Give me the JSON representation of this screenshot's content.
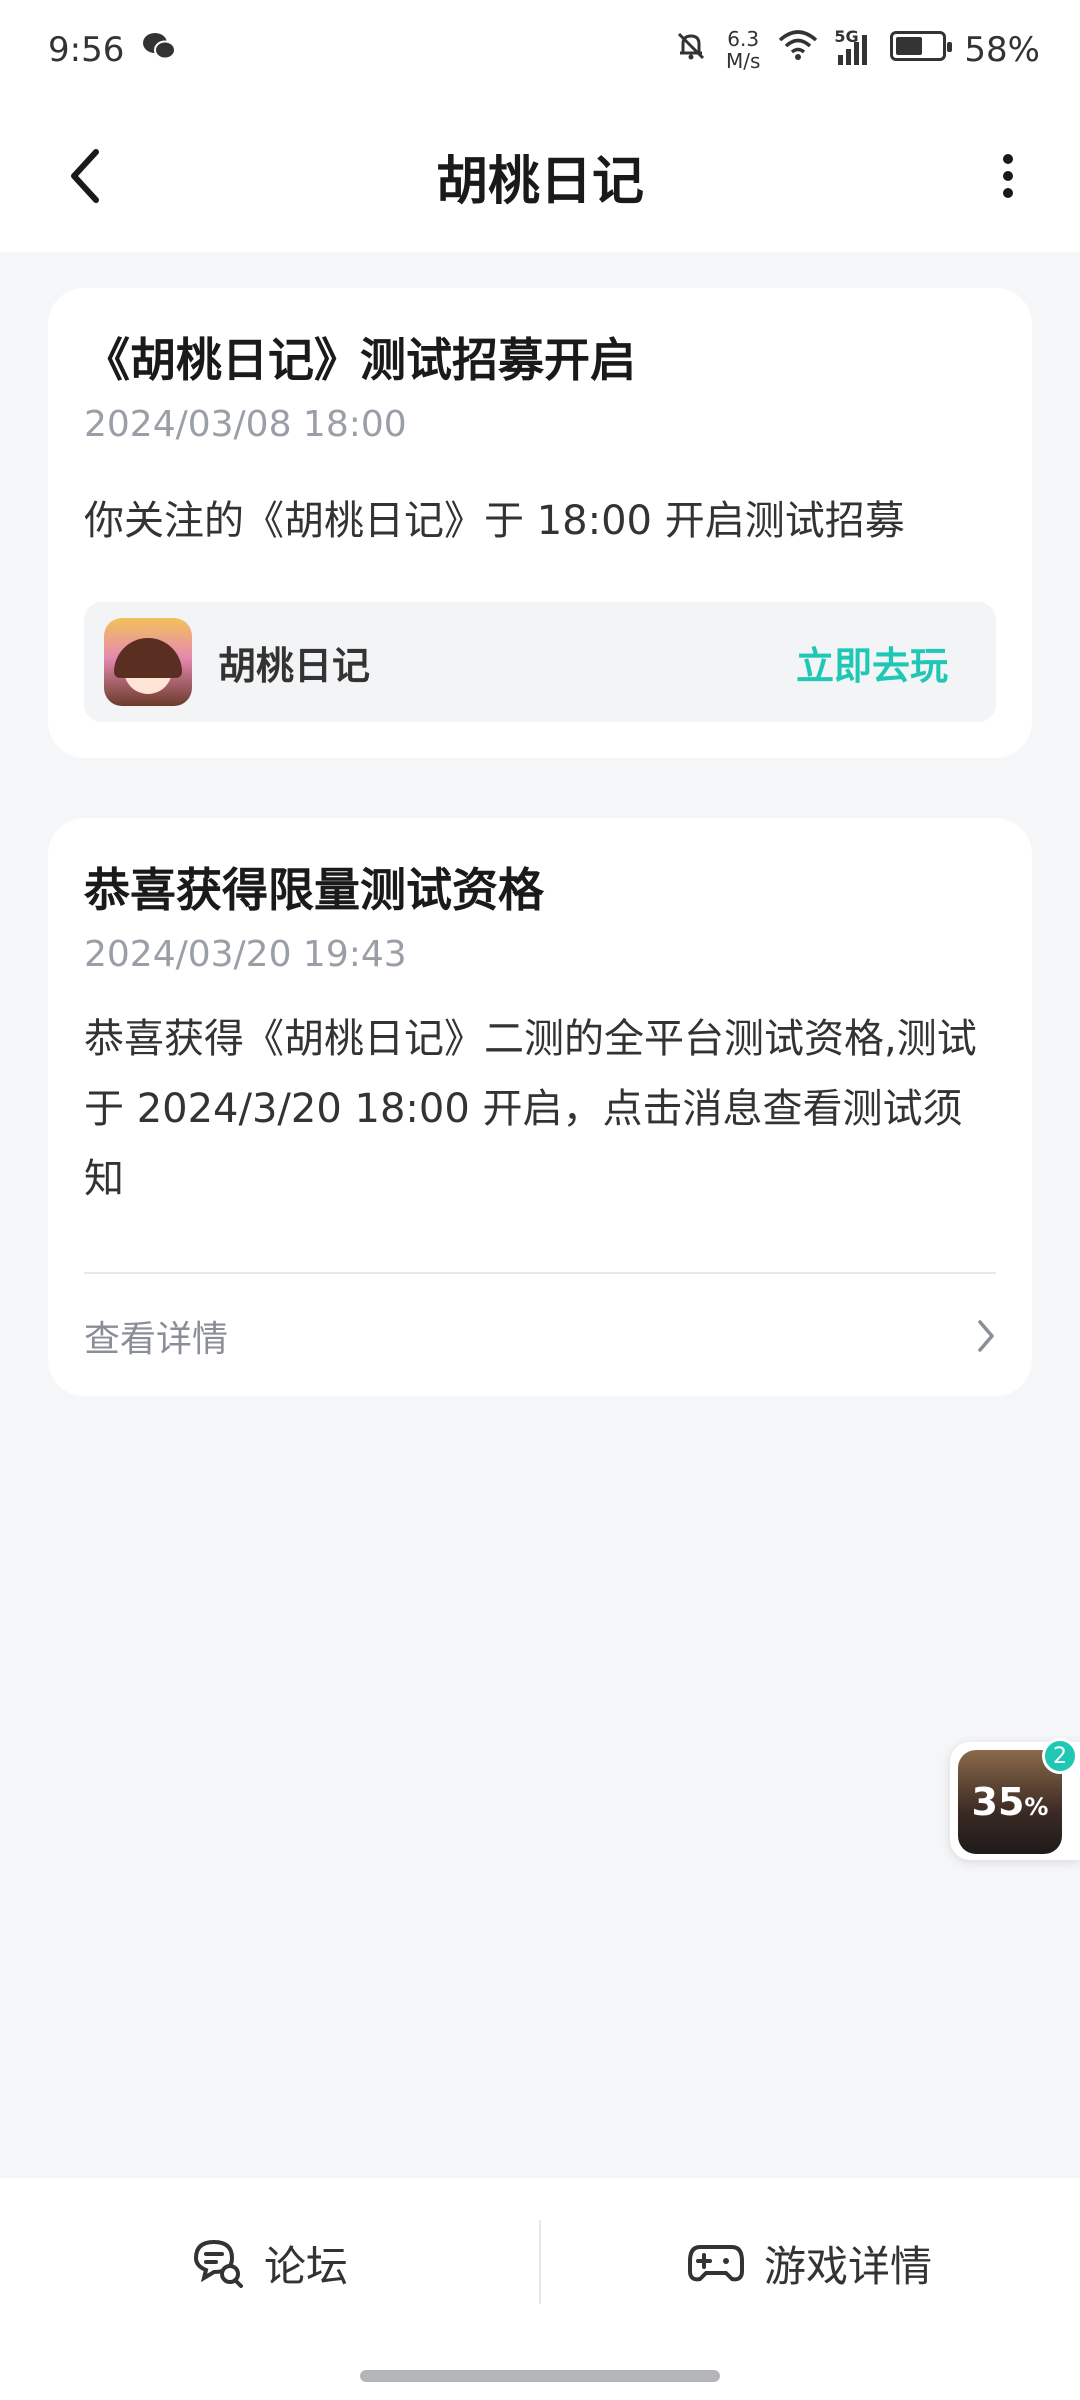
{
  "status_bar": {
    "time": "9:56",
    "speed_value": "6.3",
    "speed_unit": "M/s",
    "network": "5G",
    "battery": "58%",
    "battery_level": 0.58
  },
  "header": {
    "title": "胡桃日记"
  },
  "messages": [
    {
      "title": "《胡桃日记》测试招募开启",
      "time": "2024/03/08 18:00",
      "body": "你关注的《胡桃日记》于 18:00 开启测试招募",
      "game_name": "胡桃日记",
      "action_label": "立即去玩"
    },
    {
      "title": "恭喜获得限量测试资格",
      "time": "2024/03/20 19:43",
      "body": "恭喜获得《胡桃日记》二测的全平台测试资格,测试于 2024/3/20 18:00 开启，点击消息查看测试须知",
      "details_label": "查看详情"
    }
  ],
  "float_widget": {
    "percent": "35",
    "percent_sign": "%",
    "badge": "2"
  },
  "bottom_bar": {
    "forum_label": "论坛",
    "game_details_label": "游戏详情"
  },
  "colors": {
    "accent": "#1fc8b4",
    "background": "#f5f6f8"
  }
}
